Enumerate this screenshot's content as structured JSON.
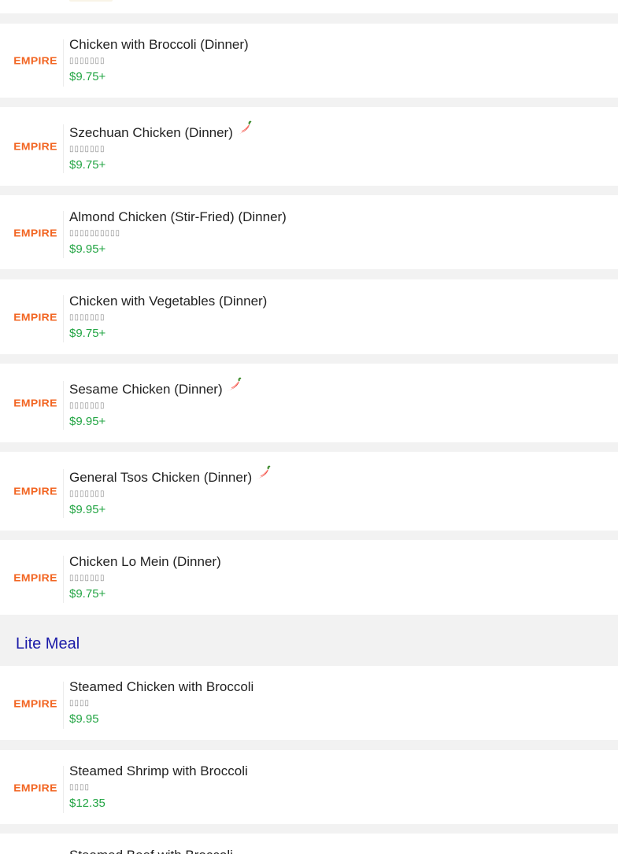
{
  "brand": {
    "logo_text": "EMPIRE",
    "accent_color": "#f26522",
    "price_color": "#23a544",
    "section_color": "#1a1aa8"
  },
  "items_dinner": [
    {
      "name": "Chicken with Broccoli (Dinner)",
      "cn": "▯▯▯▯▯▯▯",
      "price": "$9.75+",
      "spicy": false
    },
    {
      "name": "Szechuan Chicken (Dinner)",
      "cn": "▯▯▯▯▯▯▯",
      "price": "$9.75+",
      "spicy": true
    },
    {
      "name": "Almond Chicken (Stir-Fried) (Dinner)",
      "cn": "▯▯▯▯▯▯▯▯▯▯",
      "price": "$9.95+",
      "spicy": false
    },
    {
      "name": "Chicken with Vegetables (Dinner)",
      "cn": "▯▯▯▯▯▯▯",
      "price": "$9.75+",
      "spicy": false
    },
    {
      "name": "Sesame Chicken (Dinner)",
      "cn": "▯▯▯▯▯▯▯",
      "price": "$9.95+",
      "spicy": true
    },
    {
      "name": "General Tsos Chicken (Dinner)",
      "cn": "▯▯▯▯▯▯▯",
      "price": "$9.95+",
      "spicy": true
    },
    {
      "name": "Chicken Lo Mein (Dinner)",
      "cn": "▯▯▯▯▯▯▯",
      "price": "$9.75+",
      "spicy": false
    }
  ],
  "section_lite": {
    "title": "Lite Meal"
  },
  "items_lite": [
    {
      "name": "Steamed Chicken with Broccoli",
      "cn": "▯▯▯▯",
      "price": "$9.95",
      "spicy": false
    },
    {
      "name": "Steamed Shrimp with Broccoli",
      "cn": "▯▯▯▯",
      "price": "$12.35",
      "spicy": false
    },
    {
      "name": "Steamed Beef with Broccoli",
      "cn": "",
      "price": "",
      "spicy": false
    }
  ],
  "icons": {
    "spicy": "chili-pepper-icon"
  }
}
